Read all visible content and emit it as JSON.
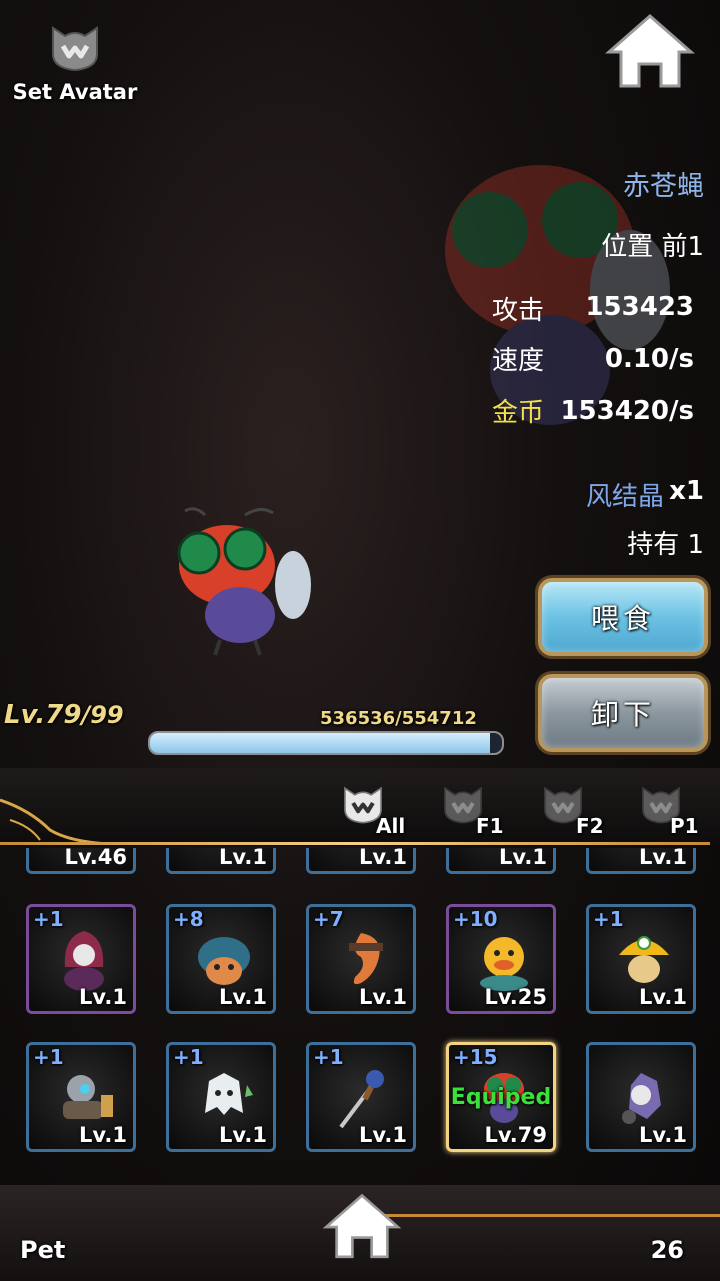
{
  "header": {
    "set_avatar_label": "Set Avatar"
  },
  "pet": {
    "name": "赤苍蝇",
    "position": "位置 前1",
    "stats": [
      {
        "label": "攻击",
        "value": "153423",
        "color": "#ffffff"
      },
      {
        "label": "速度",
        "value": "0.10/s",
        "color": "#ffffff"
      },
      {
        "label": "金币",
        "value": "153420/s",
        "color": "#f3e04a"
      }
    ],
    "item_name": "风结晶",
    "item_count": "x1",
    "held": "持有 1",
    "level": "Lv.79",
    "level_max": "/99",
    "exp_text": "536536/554712",
    "exp_fraction": 0.967
  },
  "buttons": {
    "feed": "喂食",
    "unequip": "卸下"
  },
  "tabs": [
    {
      "label": "All"
    },
    {
      "label": "F1"
    },
    {
      "label": "F2"
    },
    {
      "label": "P1"
    }
  ],
  "grid": {
    "top_row_partial": [
      "Lv.46",
      "Lv.1",
      "Lv.1",
      "Lv.1",
      "Lv.1"
    ],
    "rows": [
      [
        {
          "plus": "+1",
          "level": "Lv.1",
          "border": "purple",
          "icon": "hooded-girl-icon"
        },
        {
          "plus": "+8",
          "level": "Lv.1",
          "border": "blue",
          "icon": "bird-creature-icon"
        },
        {
          "plus": "+7",
          "level": "Lv.1",
          "border": "blue",
          "icon": "seahorse-icon"
        },
        {
          "plus": "+10",
          "level": "Lv.25",
          "border": "purple",
          "icon": "duck-icon"
        },
        {
          "plus": "+1",
          "level": "Lv.1",
          "border": "blue",
          "icon": "miner-helmet-icon"
        }
      ],
      [
        {
          "plus": "+1",
          "level": "Lv.1",
          "border": "blue",
          "icon": "robot-icon"
        },
        {
          "plus": "+1",
          "level": "Lv.1",
          "border": "blue",
          "icon": "ghost-icon"
        },
        {
          "plus": "+1",
          "level": "Lv.1",
          "border": "blue",
          "icon": "sword-imp-icon"
        },
        {
          "plus": "+15",
          "level": "Lv.79",
          "border": "selected",
          "icon": "red-fly-icon",
          "equipped": "Equiped"
        },
        {
          "plus": "",
          "level": "Lv.1",
          "border": "blue",
          "icon": "armored-pet-icon"
        }
      ]
    ]
  },
  "footer": {
    "section_label": "Pet",
    "count": "26"
  }
}
